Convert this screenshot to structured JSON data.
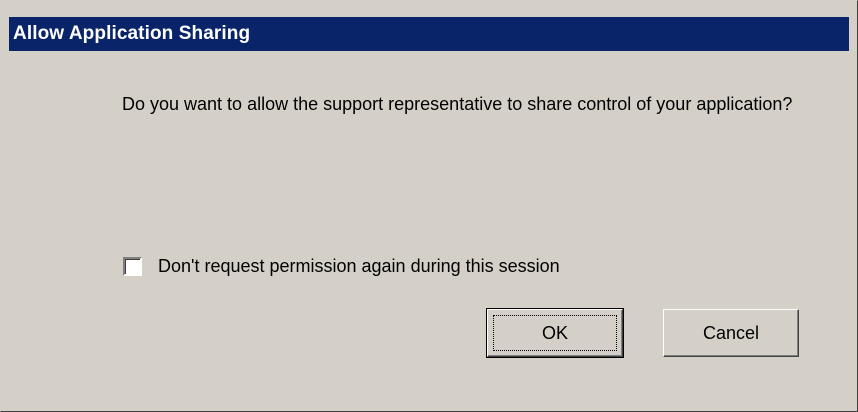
{
  "window": {
    "title": "Allow Application Sharing"
  },
  "dialog": {
    "question": "Do you want to allow the support representative to share control of your application?",
    "checkbox": {
      "label": "Don't request permission again during this session",
      "checked": false
    },
    "buttons": {
      "ok_label": "OK",
      "cancel_label": "Cancel"
    }
  },
  "colors": {
    "titlebar": "#0a246a",
    "face": "#d4d0c8"
  }
}
